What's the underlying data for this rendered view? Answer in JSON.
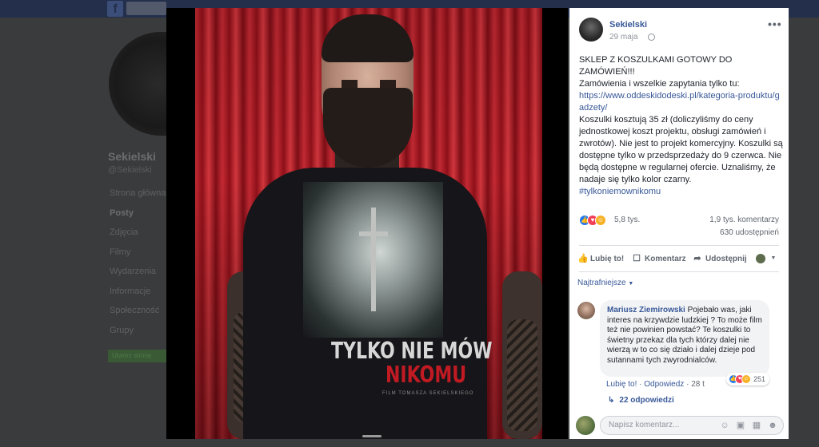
{
  "background": {
    "logo": "f",
    "profile_name": "Sekielski",
    "profile_handle": "@Sekielski",
    "nav": [
      "Strona główna",
      "Posty",
      "Zdjęcia",
      "Filmy",
      "Wydarzenia",
      "Informacje",
      "Społeczność",
      "Grupy"
    ],
    "nav_active": "Posty",
    "promo_button": "Utwórz stronę"
  },
  "photo": {
    "shirt_title": "TYLKO NIE MÓW",
    "shirt_subtitle": "NIKOMU",
    "shirt_credit": "FILM TOMASZA SEKIELSKIEGO"
  },
  "post": {
    "author": "Sekielski",
    "date": "29 maja",
    "lines": [
      "SKLEP Z KOSZULKAMI GOTOWY DO ZAMÓWIEŃ!!!",
      "Zamówienia i wszelkie zapytania tylko tu:"
    ],
    "link": "https://www.oddeskidodeski.pl/kategoria-produktu/gadzety/",
    "body": "Koszulki kosztują 35 zł (doliczyliśmy do ceny jednostkowej koszt projektu, obsługi zamówień i zwrotów). Nie jest to projekt komercyjny. Koszulki są dostępne tylko w przedsprzedaży do 9 czerwca. Nie będą dostępne w regularnej ofercie. Uznaliśmy, że nadaje się tylko kolor czarny.",
    "hashtag": "#tylkoniemownikomu",
    "reactions_count": "5,8 tys.",
    "comments_count": "1,9 tys. komentarzy",
    "shares_count": "630 udostępnień"
  },
  "actions": {
    "like": "Lubię to!",
    "comment": "Komentarz",
    "share": "Udostępnij"
  },
  "comments": {
    "sort_label": "Najtrafniejsze",
    "top": {
      "author": "Mariusz Ziemirowski",
      "text": "Pojebało was, jaki interes na krzywdzie ludzkiej ? To może film też nie powinien powstać? Te koszulki to świetny przekaz dla tych którzy dalej nie wierzą w to co się działo i dalej dzieje pod sutannami tych zwyrodnialców.",
      "reactions_count": "251",
      "like_label": "Lubię to!",
      "reply_label": "Odpowiedz",
      "time": "28 t"
    },
    "replies_label": "22 odpowiedzi",
    "composer_placeholder": "Napisz komentarz..."
  },
  "colors": {
    "link": "#385898",
    "like_reaction": "#2078f4",
    "love_reaction": "#f33e58",
    "haha_reaction": "#f7b125"
  },
  "icons": {
    "globe": "globe-icon",
    "more": "more-icon",
    "like": "thumbs-up-icon",
    "comment": "speech-bubble-icon",
    "share": "share-arrow-icon",
    "audience": "audience-selector-icon",
    "replies": "reply-arrow-icon",
    "composer": [
      "emoji-icon",
      "camera-icon",
      "gif-icon",
      "sticker-icon"
    ]
  }
}
